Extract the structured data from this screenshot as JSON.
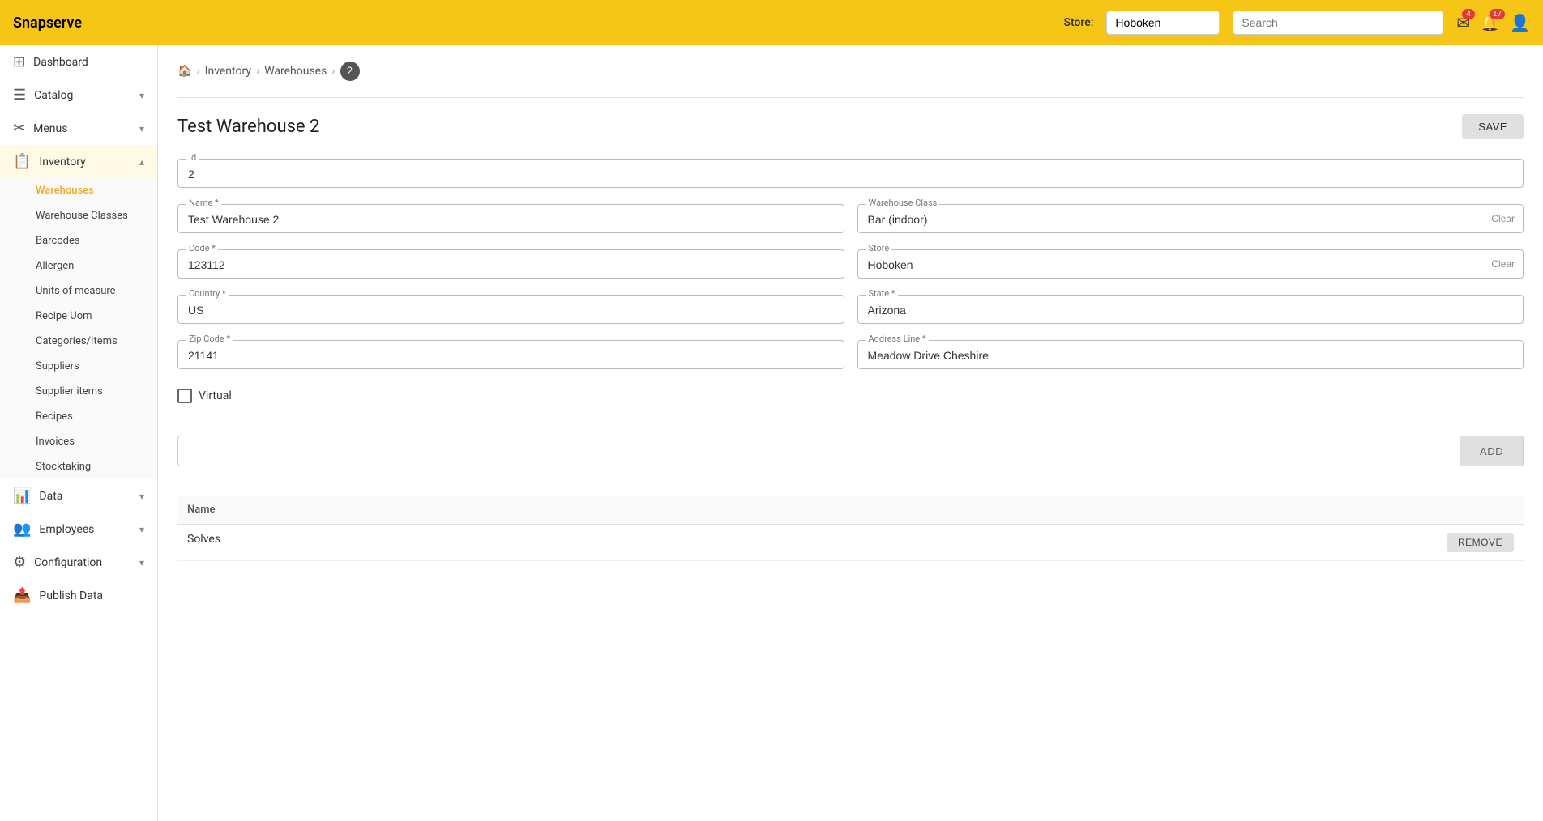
{
  "app": {
    "name": "Snapserve"
  },
  "header": {
    "store_label": "Store:",
    "store_value": "Hoboken",
    "search_placeholder": "Search",
    "notification_badge": "4",
    "alert_badge": "17"
  },
  "sidebar": {
    "items": [
      {
        "id": "dashboard",
        "label": "Dashboard",
        "icon": "⊞",
        "expandable": false
      },
      {
        "id": "catalog",
        "label": "Catalog",
        "icon": "☰",
        "expandable": true
      },
      {
        "id": "menus",
        "label": "Menus",
        "icon": "✂",
        "expandable": true
      },
      {
        "id": "inventory",
        "label": "Inventory",
        "icon": "📋",
        "expandable": true,
        "expanded": true
      }
    ],
    "inventory_subitems": [
      {
        "id": "warehouses",
        "label": "Warehouses",
        "active": true
      },
      {
        "id": "warehouse-classes",
        "label": "Warehouse Classes",
        "active": false
      },
      {
        "id": "barcodes",
        "label": "Barcodes",
        "active": false
      },
      {
        "id": "allergen",
        "label": "Allergen",
        "active": false
      },
      {
        "id": "units-of-measure",
        "label": "Units of measure",
        "active": false
      },
      {
        "id": "recipe-uom",
        "label": "Recipe Uom",
        "active": false
      },
      {
        "id": "categories-items",
        "label": "Categories/Items",
        "active": false
      },
      {
        "id": "suppliers",
        "label": "Suppliers",
        "active": false
      },
      {
        "id": "supplier-items",
        "label": "Supplier items",
        "active": false
      },
      {
        "id": "recipes",
        "label": "Recipes",
        "active": false
      },
      {
        "id": "invoices",
        "label": "Invoices",
        "active": false
      },
      {
        "id": "stocktaking",
        "label": "Stocktaking",
        "active": false
      }
    ],
    "bottom_items": [
      {
        "id": "data",
        "label": "Data",
        "icon": "📊",
        "expandable": true
      },
      {
        "id": "employees",
        "label": "Employees",
        "icon": "👥",
        "expandable": true
      },
      {
        "id": "configuration",
        "label": "Configuration",
        "icon": "⚙",
        "expandable": true
      },
      {
        "id": "publish-data",
        "label": "Publish Data",
        "icon": "📤",
        "expandable": false
      }
    ]
  },
  "breadcrumb": {
    "home_icon": "🏠",
    "items": [
      "Inventory",
      "Warehouses"
    ],
    "current": "2"
  },
  "page": {
    "title": "Test Warehouse 2",
    "save_label": "SAVE"
  },
  "form": {
    "id_label": "Id",
    "id_value": "2",
    "name_label": "Name *",
    "name_value": "Test Warehouse 2",
    "warehouse_class_label": "Warehouse Class",
    "warehouse_class_value": "Bar (indoor)",
    "code_label": "Code *",
    "code_value": "123112",
    "store_label": "Store",
    "store_value": "Hoboken",
    "country_label": "Country *",
    "country_value": "US",
    "state_label": "State *",
    "state_value": "Arizona",
    "zip_label": "Zip Code *",
    "zip_value": "21141",
    "address_label": "Address Line *",
    "address_value": "Meadow Drive Cheshire",
    "virtual_label": "Virtual"
  },
  "table": {
    "add_placeholder": "",
    "add_button": "ADD",
    "columns": [
      "Name"
    ],
    "rows": [
      {
        "name": "Solves"
      }
    ],
    "remove_button": "REMOVE"
  }
}
